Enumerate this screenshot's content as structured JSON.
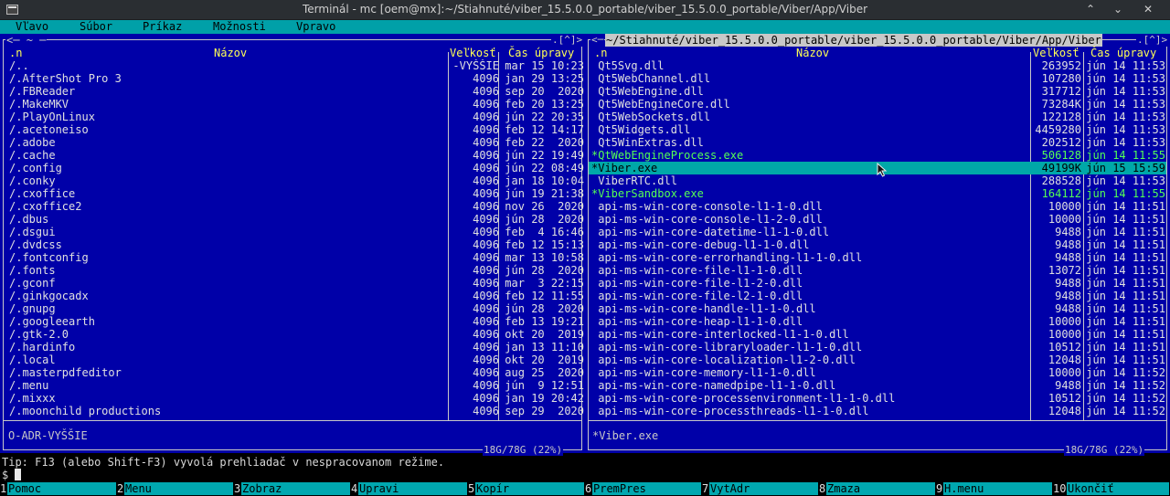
{
  "window": {
    "title": "Terminál - mc [oem@mx]:~/Stiahnuté/viber_15.5.0.0_portable/viber_15.5.0.0_portable/Viber/App/Viber",
    "icons": [
      "terminal-icon",
      "chevron-up-icon",
      "chevron-down-icon",
      "close-icon"
    ]
  },
  "menubar": [
    "Vľavo",
    "Súbor",
    "Príkaz",
    "Možnosti",
    "Vpravo"
  ],
  "left_panel": {
    "path": "~",
    "corner": "[^]",
    "headers": {
      "name_sort": ".n",
      "name": "Názov",
      "size": "Veľkosť",
      "mtime": "Čas úpravy"
    },
    "rows": [
      {
        "name": "/..",
        "size": "-VYŠŠIE",
        "mtime": "mar 15 10:23"
      },
      {
        "name": "/.AfterShot Pro 3",
        "size": "4096",
        "mtime": "jan 29 13:25"
      },
      {
        "name": "/.FBReader",
        "size": "4096",
        "mtime": "sep 20  2020"
      },
      {
        "name": "/.MakeMKV",
        "size": "4096",
        "mtime": "feb 20 13:25"
      },
      {
        "name": "/.PlayOnLinux",
        "size": "4096",
        "mtime": "jún 22 20:35"
      },
      {
        "name": "/.acetoneiso",
        "size": "4096",
        "mtime": "feb 12 14:17"
      },
      {
        "name": "/.adobe",
        "size": "4096",
        "mtime": "feb 22  2020"
      },
      {
        "name": "/.cache",
        "size": "4096",
        "mtime": "jún 22 19:49"
      },
      {
        "name": "/.config",
        "size": "4096",
        "mtime": "jún 22 08:49"
      },
      {
        "name": "/.conky",
        "size": "4096",
        "mtime": "jan 18 10:04"
      },
      {
        "name": "/.cxoffice",
        "size": "4096",
        "mtime": "jún 19 21:38"
      },
      {
        "name": "/.cxoffice2",
        "size": "4096",
        "mtime": "nov 26  2020"
      },
      {
        "name": "/.dbus",
        "size": "4096",
        "mtime": "jún 28  2020"
      },
      {
        "name": "/.dsgui",
        "size": "4096",
        "mtime": "feb  4 16:46"
      },
      {
        "name": "/.dvdcss",
        "size": "4096",
        "mtime": "feb 12 15:13"
      },
      {
        "name": "/.fontconfig",
        "size": "4096",
        "mtime": "mar 13 10:58"
      },
      {
        "name": "/.fonts",
        "size": "4096",
        "mtime": "jún 28  2020"
      },
      {
        "name": "/.gconf",
        "size": "4096",
        "mtime": "mar  3 22:15"
      },
      {
        "name": "/.ginkgocadx",
        "size": "4096",
        "mtime": "feb 12 11:55"
      },
      {
        "name": "/.gnupg",
        "size": "4096",
        "mtime": "jún 28  2020"
      },
      {
        "name": "/.googleearth",
        "size": "4096",
        "mtime": "feb 13 19:21"
      },
      {
        "name": "/.gtk-2.0",
        "size": "4096",
        "mtime": "okt 20  2019"
      },
      {
        "name": "/.hardinfo",
        "size": "4096",
        "mtime": "jan 13 11:10"
      },
      {
        "name": "/.local",
        "size": "4096",
        "mtime": "okt 20  2019"
      },
      {
        "name": "/.masterpdfeditor",
        "size": "4096",
        "mtime": "aug 25  2020"
      },
      {
        "name": "/.menu",
        "size": "4096",
        "mtime": "jún  9 12:51"
      },
      {
        "name": "/.mixxx",
        "size": "4096",
        "mtime": "jan 19 20:42"
      },
      {
        "name": "/.moonchild productions",
        "size": "4096",
        "mtime": "sep 29  2020"
      }
    ],
    "mini_status": "O-ADR-VYŠŠIE",
    "disk": "18G/78G (22%)"
  },
  "right_panel": {
    "path": "~/Stiahnuté/viber_15.5.0.0_portable/viber_15.5.0.0_portable/Viber/App/Viber",
    "corner": "[^]",
    "headers": {
      "name_sort": ".n",
      "name": "Názov",
      "size": "Veľkosť",
      "mtime": "Čas úpravy"
    },
    "rows": [
      {
        "name": " Qt5Svg.dll",
        "size": "263952",
        "mtime": "jún 14 11:53",
        "kind": "file"
      },
      {
        "name": " Qt5WebChannel.dll",
        "size": "107280",
        "mtime": "jún 14 11:53",
        "kind": "file"
      },
      {
        "name": " Qt5WebEngine.dll",
        "size": "317712",
        "mtime": "jún 14 11:53",
        "kind": "file"
      },
      {
        "name": " Qt5WebEngineCore.dll",
        "size": "73284K",
        "mtime": "jún 14 11:53",
        "kind": "file"
      },
      {
        "name": " Qt5WebSockets.dll",
        "size": "122128",
        "mtime": "jún 14 11:53",
        "kind": "file"
      },
      {
        "name": " Qt5Widgets.dll",
        "size": "4459280",
        "mtime": "jún 14 11:53",
        "kind": "file"
      },
      {
        "name": " Qt5WinExtras.dll",
        "size": "202512",
        "mtime": "jún 14 11:53",
        "kind": "file"
      },
      {
        "name": "*QtWebEngineProcess.exe",
        "size": "506128",
        "mtime": "jún 14 11:55",
        "kind": "exe"
      },
      {
        "name": "*Viber.exe",
        "size": "49199K",
        "mtime": "jún 15 15:59",
        "kind": "selected"
      },
      {
        "name": " ViberRTC.dll",
        "size": "288528",
        "mtime": "jún 14 11:53",
        "kind": "file"
      },
      {
        "name": "*ViberSandbox.exe",
        "size": "164112",
        "mtime": "jún 14 11:55",
        "kind": "exe"
      },
      {
        "name": " api-ms-win-core-console-l1-1-0.dll",
        "size": "10000",
        "mtime": "jún 14 11:51",
        "kind": "file"
      },
      {
        "name": " api-ms-win-core-console-l1-2-0.dll",
        "size": "10000",
        "mtime": "jún 14 11:51",
        "kind": "file"
      },
      {
        "name": " api-ms-win-core-datetime-l1-1-0.dll",
        "size": "9488",
        "mtime": "jún 14 11:51",
        "kind": "file"
      },
      {
        "name": " api-ms-win-core-debug-l1-1-0.dll",
        "size": "9488",
        "mtime": "jún 14 11:51",
        "kind": "file"
      },
      {
        "name": " api-ms-win-core-errorhandling-l1-1-0.dll",
        "size": "9488",
        "mtime": "jún 14 11:51",
        "kind": "file"
      },
      {
        "name": " api-ms-win-core-file-l1-1-0.dll",
        "size": "13072",
        "mtime": "jún 14 11:51",
        "kind": "file"
      },
      {
        "name": " api-ms-win-core-file-l1-2-0.dll",
        "size": "9488",
        "mtime": "jún 14 11:51",
        "kind": "file"
      },
      {
        "name": " api-ms-win-core-file-l2-1-0.dll",
        "size": "9488",
        "mtime": "jún 14 11:51",
        "kind": "file"
      },
      {
        "name": " api-ms-win-core-handle-l1-1-0.dll",
        "size": "9488",
        "mtime": "jún 14 11:51",
        "kind": "file"
      },
      {
        "name": " api-ms-win-core-heap-l1-1-0.dll",
        "size": "10000",
        "mtime": "jún 14 11:51",
        "kind": "file"
      },
      {
        "name": " api-ms-win-core-interlocked-l1-1-0.dll",
        "size": "10000",
        "mtime": "jún 14 11:51",
        "kind": "file"
      },
      {
        "name": " api-ms-win-core-libraryloader-l1-1-0.dll",
        "size": "10512",
        "mtime": "jún 14 11:51",
        "kind": "file"
      },
      {
        "name": " api-ms-win-core-localization-l1-2-0.dll",
        "size": "12048",
        "mtime": "jún 14 11:51",
        "kind": "file"
      },
      {
        "name": " api-ms-win-core-memory-l1-1-0.dll",
        "size": "10000",
        "mtime": "jún 14 11:52",
        "kind": "file"
      },
      {
        "name": " api-ms-win-core-namedpipe-l1-1-0.dll",
        "size": "9488",
        "mtime": "jún 14 11:52",
        "kind": "file"
      },
      {
        "name": " api-ms-win-core-processenvironment-l1-1-0.dll",
        "size": "10512",
        "mtime": "jún 14 11:52",
        "kind": "file"
      },
      {
        "name": " api-ms-win-core-processthreads-l1-1-0.dll",
        "size": "12048",
        "mtime": "jún 14 11:52",
        "kind": "file"
      }
    ],
    "mini_status": "*Viber.exe",
    "disk": "18G/78G (22%)"
  },
  "tip": "Tip: F13 (alebo Shift-F3) vyvolá prehliadač v nespracovanom režime.",
  "prompt": "$",
  "fkeys": [
    {
      "num": "1",
      "label": "Pomoc"
    },
    {
      "num": "2",
      "label": "Menu"
    },
    {
      "num": "3",
      "label": "Zobraz"
    },
    {
      "num": "4",
      "label": "Upravi"
    },
    {
      "num": "5",
      "label": "Kopír"
    },
    {
      "num": "6",
      "label": "PremPres"
    },
    {
      "num": "7",
      "label": "VytAdr"
    },
    {
      "num": "8",
      "label": "Zmaza"
    },
    {
      "num": "9",
      "label": "H.menu"
    },
    {
      "num": "10",
      "label": "Ukončiť"
    }
  ],
  "colors": {
    "panel_bg": "#0000a8",
    "menubar_bg": "#00a0a8",
    "selection_bg": "#00a8a8",
    "executable": "#55ff55",
    "header": "#ffff55"
  }
}
